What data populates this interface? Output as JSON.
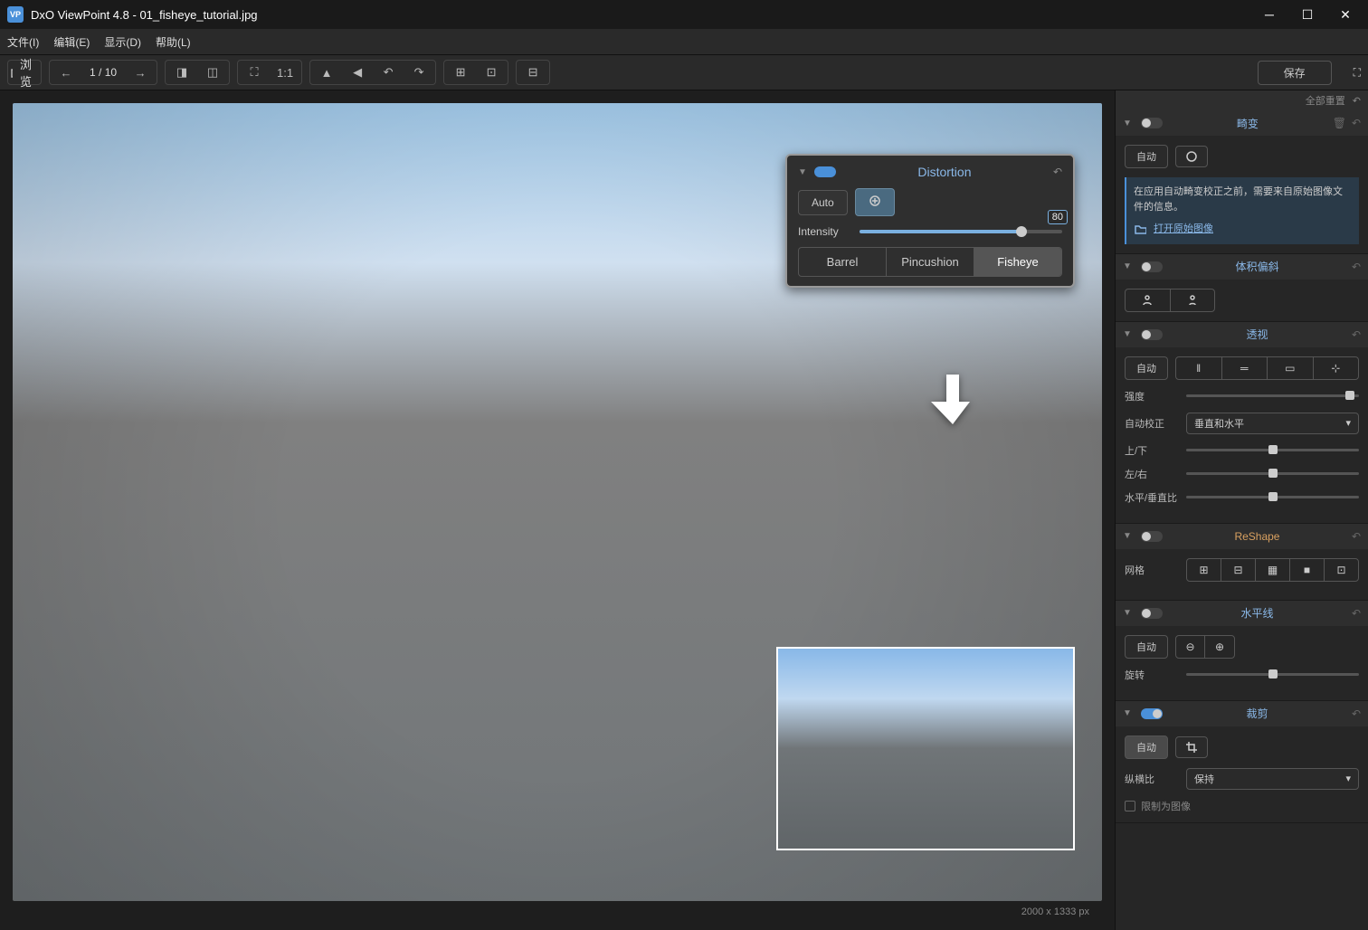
{
  "titlebar": {
    "app": "DxO ViewPoint 4.8",
    "file": "01_fisheye_tutorial.jpg"
  },
  "menu": {
    "file": "文件(I)",
    "edit": "编辑(E)",
    "view": "显示(D)",
    "help": "帮助(L)"
  },
  "toolbar": {
    "browse": "浏览",
    "page_current": "1",
    "page_sep": "/",
    "page_total": "10",
    "fit": "1:1",
    "save": "保存"
  },
  "overlay": {
    "title": "Distortion",
    "auto": "Auto",
    "intensity_label": "Intensity",
    "intensity_value": "80",
    "tab_barrel": "Barrel",
    "tab_pincushion": "Pincushion",
    "tab_fisheye": "Fisheye"
  },
  "status": {
    "dimensions": "2000 x 1333 px"
  },
  "sidebar": {
    "reset_all": "全部重置",
    "distortion": {
      "title": "畸变",
      "auto": "自动",
      "info": "在应用自动畸变校正之前，需要来自原始图像文件的信息。",
      "open_original": "打开原始图像"
    },
    "volume": {
      "title": "体积偏斜"
    },
    "perspective": {
      "title": "透视",
      "auto": "自动",
      "intensity": "强度",
      "autocorrect": "自动校正",
      "autocorrect_value": "垂直和水平",
      "updown": "上/下",
      "leftright": "左/右",
      "hvratio": "水平/垂直比"
    },
    "reshape": {
      "title": "ReShape",
      "grid": "网格"
    },
    "horizon": {
      "title": "水平线",
      "auto": "自动",
      "rotate": "旋转"
    },
    "crop": {
      "title": "裁剪",
      "auto": "自动",
      "ratio": "纵横比",
      "ratio_value": "保持",
      "constrain": "限制为图像"
    }
  }
}
